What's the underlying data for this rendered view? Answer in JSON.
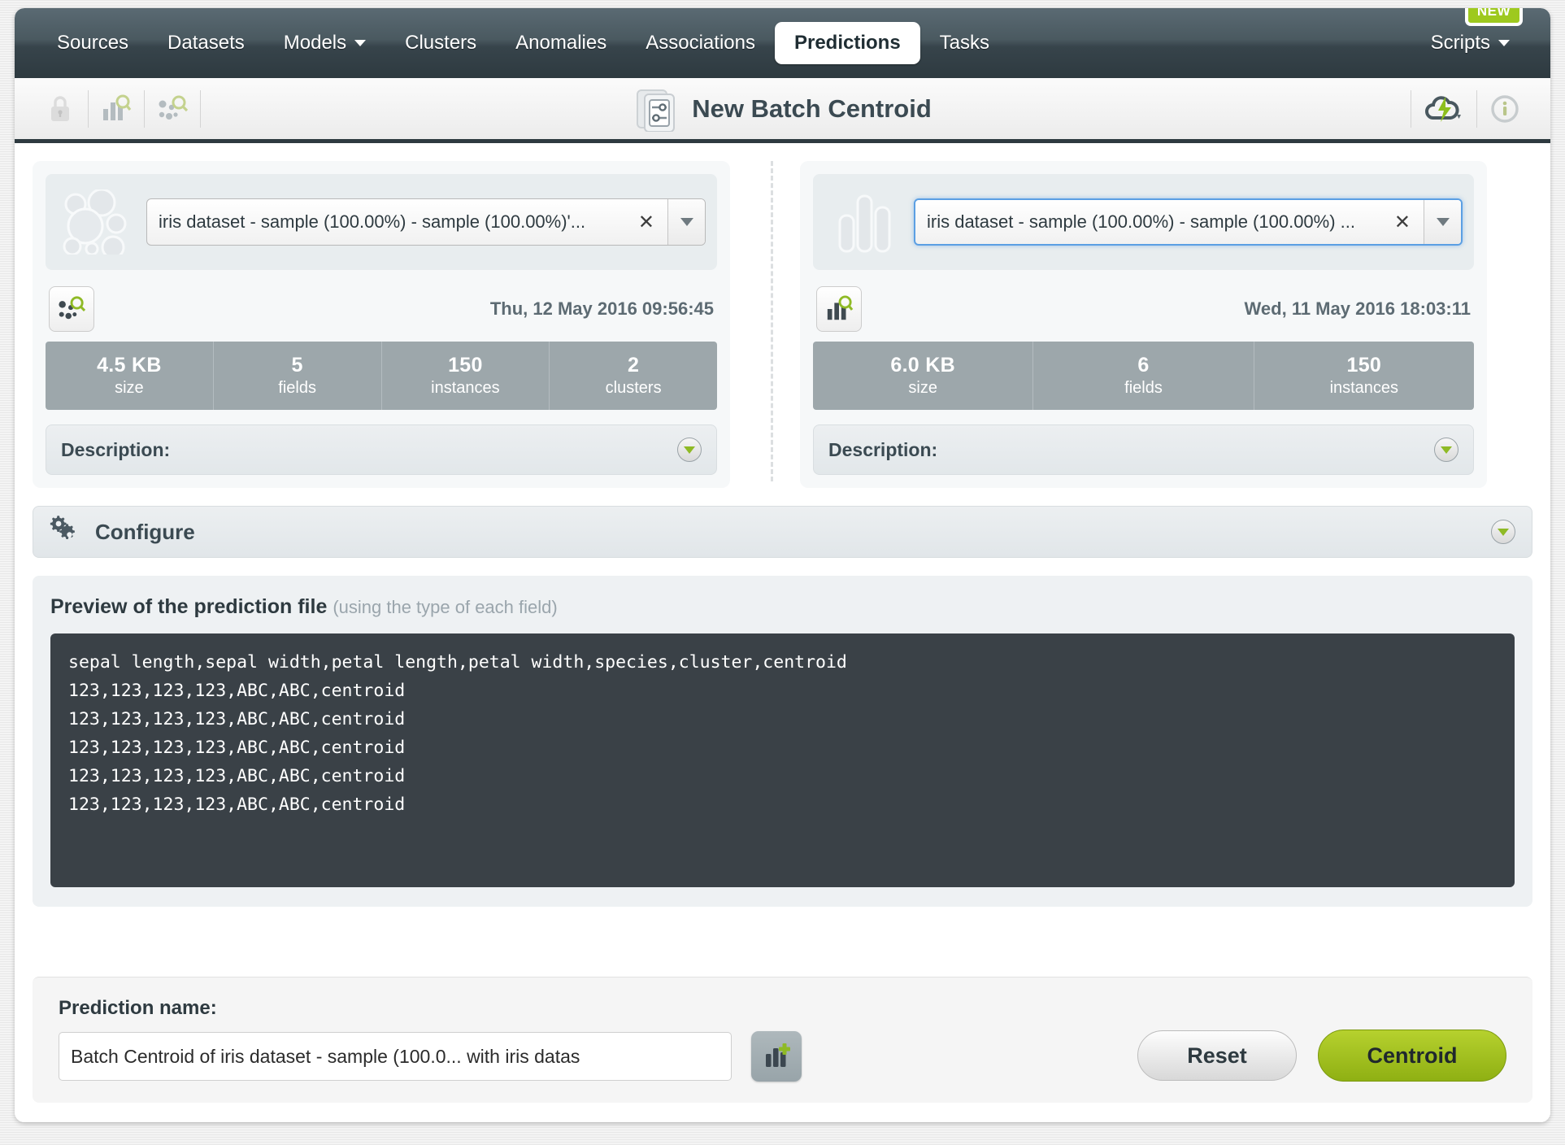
{
  "nav": {
    "items": [
      {
        "label": "Sources",
        "active": false,
        "dropdown": false
      },
      {
        "label": "Datasets",
        "active": false,
        "dropdown": false
      },
      {
        "label": "Models",
        "active": false,
        "dropdown": true
      },
      {
        "label": "Clusters",
        "active": false,
        "dropdown": false
      },
      {
        "label": "Anomalies",
        "active": false,
        "dropdown": false
      },
      {
        "label": "Associations",
        "active": false,
        "dropdown": false
      },
      {
        "label": "Predictions",
        "active": true,
        "dropdown": false
      },
      {
        "label": "Tasks",
        "active": false,
        "dropdown": false
      }
    ],
    "right": {
      "label": "Scripts",
      "badge": "NEW"
    }
  },
  "toolbar": {
    "title": "New Batch Centroid",
    "left_icons": [
      "lock-icon",
      "dataset-search-icon",
      "cluster-search-icon"
    ],
    "right_icons": [
      "cloud-bolt-icon",
      "info-icon"
    ]
  },
  "left_panel": {
    "selector": {
      "value": "iris dataset - sample (100.00%) - sample (100.00%)'...",
      "icon": "cluster-bubbles-icon",
      "clear": "✕",
      "focused": false
    },
    "resource_icon": "cluster-search-icon",
    "date": "Thu, 12 May 2016 09:56:45",
    "stats": [
      {
        "value": "4.5 KB",
        "label": "size"
      },
      {
        "value": "5",
        "label": "fields"
      },
      {
        "value": "150",
        "label": "instances"
      },
      {
        "value": "2",
        "label": "clusters"
      }
    ],
    "description_label": "Description:"
  },
  "right_panel": {
    "selector": {
      "value": "iris dataset - sample (100.00%) - sample (100.00%) ...",
      "icon": "dataset-bars-icon",
      "clear": "✕",
      "focused": true
    },
    "resource_icon": "dataset-search-icon",
    "date": "Wed, 11 May 2016 18:03:11",
    "stats": [
      {
        "value": "6.0 KB",
        "label": "size"
      },
      {
        "value": "6",
        "label": "fields"
      },
      {
        "value": "150",
        "label": "instances"
      }
    ],
    "description_label": "Description:"
  },
  "configure": {
    "label": "Configure",
    "icon": "gears-icon"
  },
  "preview": {
    "title": "Preview of the prediction file",
    "subtitle": "(using the type of each field)",
    "lines": [
      "sepal length,sepal width,petal length,petal width,species,cluster,centroid",
      "123,123,123,123,ABC,ABC,centroid",
      "123,123,123,123,ABC,ABC,centroid",
      "123,123,123,123,ABC,ABC,centroid",
      "123,123,123,123,ABC,ABC,centroid",
      "123,123,123,123,ABC,ABC,centroid"
    ]
  },
  "footer": {
    "name_label": "Prediction name:",
    "name_value": "Batch Centroid of iris dataset - sample (100.0... with iris datas",
    "name_placeholder": "Prediction name",
    "icon_button": "add-dataset-icon",
    "reset_label": "Reset",
    "primary_label": "Centroid"
  },
  "colors": {
    "nav_bg": "#37444b",
    "accent_green": "#9ec91e",
    "primary_button": "#a4c31f",
    "stats_bg": "#9da7ab",
    "code_bg": "#3a4147",
    "focus_blue": "#5b9fe3"
  }
}
